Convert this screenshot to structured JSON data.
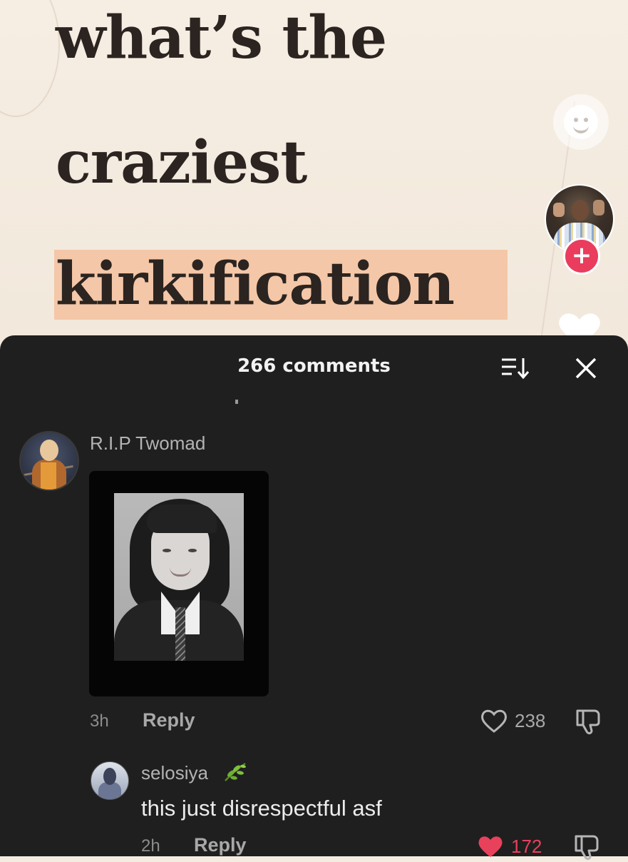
{
  "video": {
    "headline": [
      "what’s the",
      "craziest",
      "kirkification"
    ]
  },
  "comments_sheet": {
    "title": "266 comments",
    "comments": [
      {
        "username": "R.I.P Twomad",
        "time": "3h",
        "reply_label": "Reply",
        "like_count": "238",
        "liked": false,
        "has_image": true
      },
      {
        "username": "selosiya",
        "text": "this just disrespectful asf",
        "time": "2h",
        "reply_label": "Reply",
        "like_count": "172",
        "liked": true
      }
    ]
  },
  "colors": {
    "highlight": "#f4c7a8",
    "sheet_bg": "#1f1f1f",
    "like_red": "#e8415c",
    "follow_red": "#ea3c5d"
  },
  "icons": [
    "emoji-reaction-icon",
    "creator-avatar",
    "follow-plus-icon",
    "heart-icon",
    "sort-icon",
    "close-icon",
    "dislike-icon",
    "leaf-emoji-icon"
  ]
}
